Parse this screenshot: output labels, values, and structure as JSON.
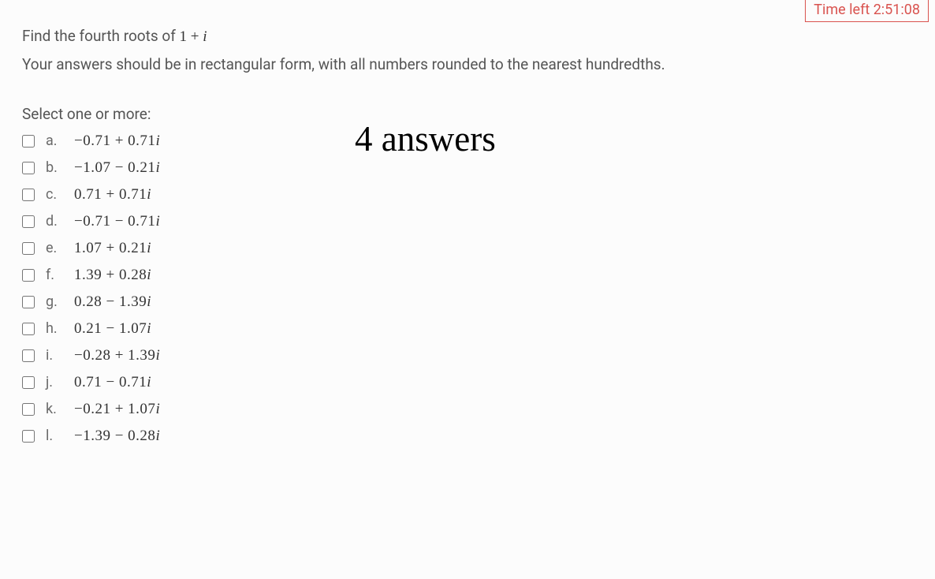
{
  "timer": {
    "label": "Time left",
    "value": "2:51:08"
  },
  "question": {
    "prefix": "Find the fourth roots of ",
    "expression": "1 + i",
    "instruction": "Your answers should be in rectangular form, with all numbers rounded to the nearest hundredths."
  },
  "prompt": "Select one or more:",
  "options": [
    {
      "letter": "a.",
      "re": "−0.71",
      "op": "+",
      "im": "0.71"
    },
    {
      "letter": "b.",
      "re": "−1.07",
      "op": "−",
      "im": "0.21"
    },
    {
      "letter": "c.",
      "re": "0.71",
      "op": "+",
      "im": "0.71"
    },
    {
      "letter": "d.",
      "re": "−0.71",
      "op": "−",
      "im": "0.71"
    },
    {
      "letter": "e.",
      "re": "1.07",
      "op": "+",
      "im": "0.21"
    },
    {
      "letter": "f.",
      "re": "1.39",
      "op": "+",
      "im": "0.28"
    },
    {
      "letter": "g.",
      "re": "0.28",
      "op": "−",
      "im": "1.39"
    },
    {
      "letter": "h.",
      "re": "0.21",
      "op": "−",
      "im": "1.07"
    },
    {
      "letter": "i.",
      "re": "−0.28",
      "op": "+",
      "im": "1.39"
    },
    {
      "letter": "j.",
      "re": "0.71",
      "op": "−",
      "im": "0.71"
    },
    {
      "letter": "k.",
      "re": "−0.21",
      "op": "+",
      "im": "1.07"
    },
    {
      "letter": "l.",
      "re": "−1.39",
      "op": "−",
      "im": "0.28"
    }
  ],
  "annotation": "4  answers"
}
